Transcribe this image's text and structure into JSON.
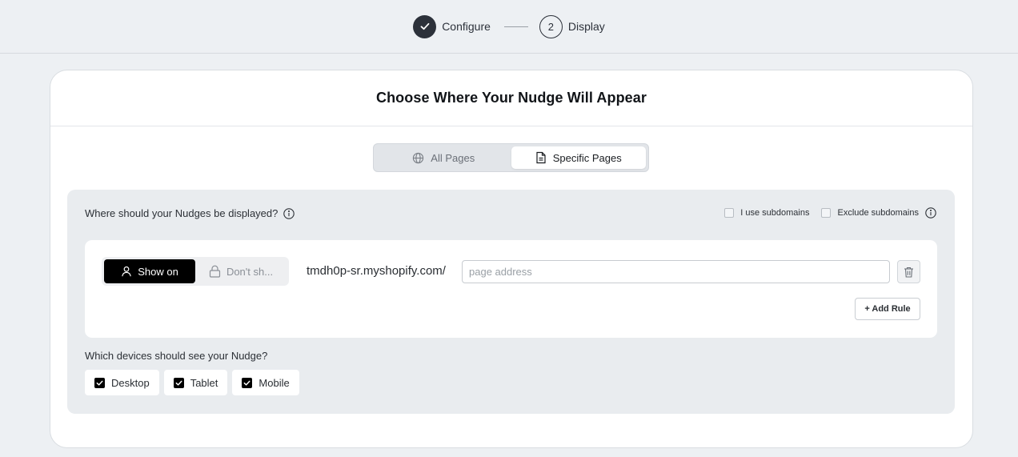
{
  "stepper": {
    "steps": [
      {
        "label": "Configure",
        "state": "done"
      },
      {
        "label": "Display",
        "number": "2",
        "state": "todo"
      }
    ]
  },
  "card": {
    "title": "Choose Where Your Nudge Will Appear"
  },
  "page_scope": {
    "options": [
      "All Pages",
      "Specific Pages"
    ],
    "selected": "Specific Pages"
  },
  "display_rules": {
    "question": "Where should your Nudges be displayed?",
    "subdomain_options": [
      {
        "label": "I use subdomains",
        "checked": false
      },
      {
        "label": "Exclude subdomains",
        "checked": false
      }
    ],
    "rule": {
      "show_on_label": "Show on",
      "dont_show_label": "Don't sh...",
      "selected": "Show on",
      "domain": "tmdh0p-sr.myshopify.com/",
      "page_address_value": "",
      "page_address_placeholder": "page address"
    },
    "add_rule_label": "+ Add Rule"
  },
  "devices": {
    "question": "Which devices should see your Nudge?",
    "options": [
      {
        "label": "Desktop",
        "checked": true
      },
      {
        "label": "Tablet",
        "checked": true
      },
      {
        "label": "Mobile",
        "checked": true
      }
    ]
  },
  "colors": {
    "background": "#edf0f3",
    "accent_dark": "#2c313a",
    "toggle_active": "#000000"
  },
  "icons": [
    "check-icon",
    "globe-icon",
    "document-icon",
    "info-icon",
    "user-icon",
    "lock-icon",
    "trash-icon"
  ]
}
